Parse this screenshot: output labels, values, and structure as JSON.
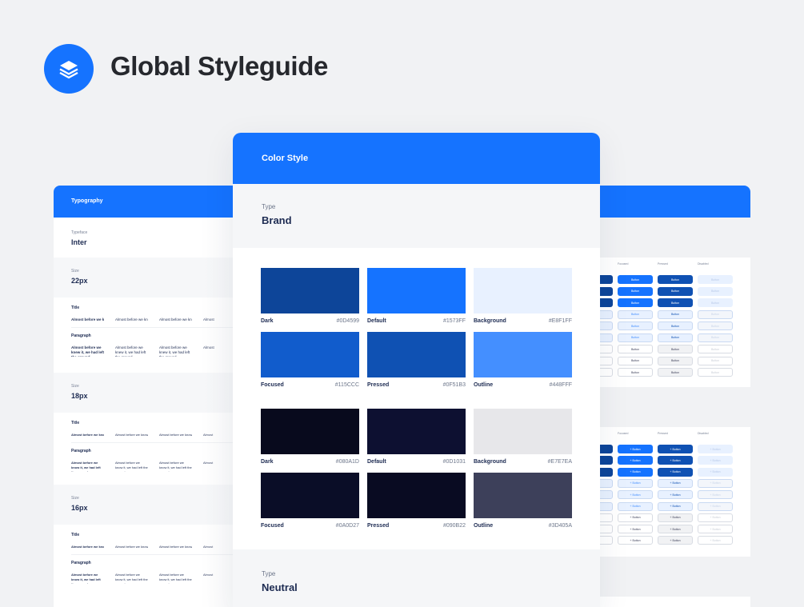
{
  "header": {
    "title": "Global Styleguide",
    "logo_icon": "layers-icon",
    "logo_color": "#1573FF"
  },
  "typography_card": {
    "title": "Typography",
    "typeface_label": "Typeface",
    "typeface_value": "Inter",
    "sizes": [
      {
        "label": "Size",
        "value": "22px"
      },
      {
        "label": "Size",
        "value": "18px"
      },
      {
        "label": "Size",
        "value": "16px"
      }
    ],
    "sample_title_label": "Title",
    "sample_paragraph_label": "Paragraph",
    "sample_title_text": "Almost before we knew",
    "sample_title_text_alt": "Almost before we know",
    "sample_paragraph_text": "Almost before we knew it, we had left the ground",
    "sample_paragraph_text_alt": "Almost before we know it, we had left the ground",
    "sample_truncated": "Almost"
  },
  "buttons_card": {
    "columns": [
      "Focused",
      "Pressed",
      "Disabled"
    ],
    "button_label": "Button",
    "button_label_plus": "+ Button"
  },
  "color_card": {
    "title": "Color Style",
    "type_label": "Type",
    "brand_label": "Brand",
    "neutral_label": "Neutral",
    "swatches": [
      {
        "name": "Dark",
        "hex": "#0D4599"
      },
      {
        "name": "Default",
        "hex": "#1573FF"
      },
      {
        "name": "Background",
        "hex": "#E8F1FF"
      },
      {
        "name": "Focused",
        "hex": "#115CCC"
      },
      {
        "name": "Pressed",
        "hex": "#0F51B3"
      },
      {
        "name": "Outline",
        "hex": "#448FFF"
      },
      {
        "name": "Dark",
        "hex": "#080A1D"
      },
      {
        "name": "Default",
        "hex": "#0D1031"
      },
      {
        "name": "Background",
        "hex": "#E7E7EA"
      },
      {
        "name": "Focused",
        "hex": "#0A0D27"
      },
      {
        "name": "Pressed",
        "hex": "#090B22"
      },
      {
        "name": "Outline",
        "hex": "#3D405A"
      }
    ]
  }
}
